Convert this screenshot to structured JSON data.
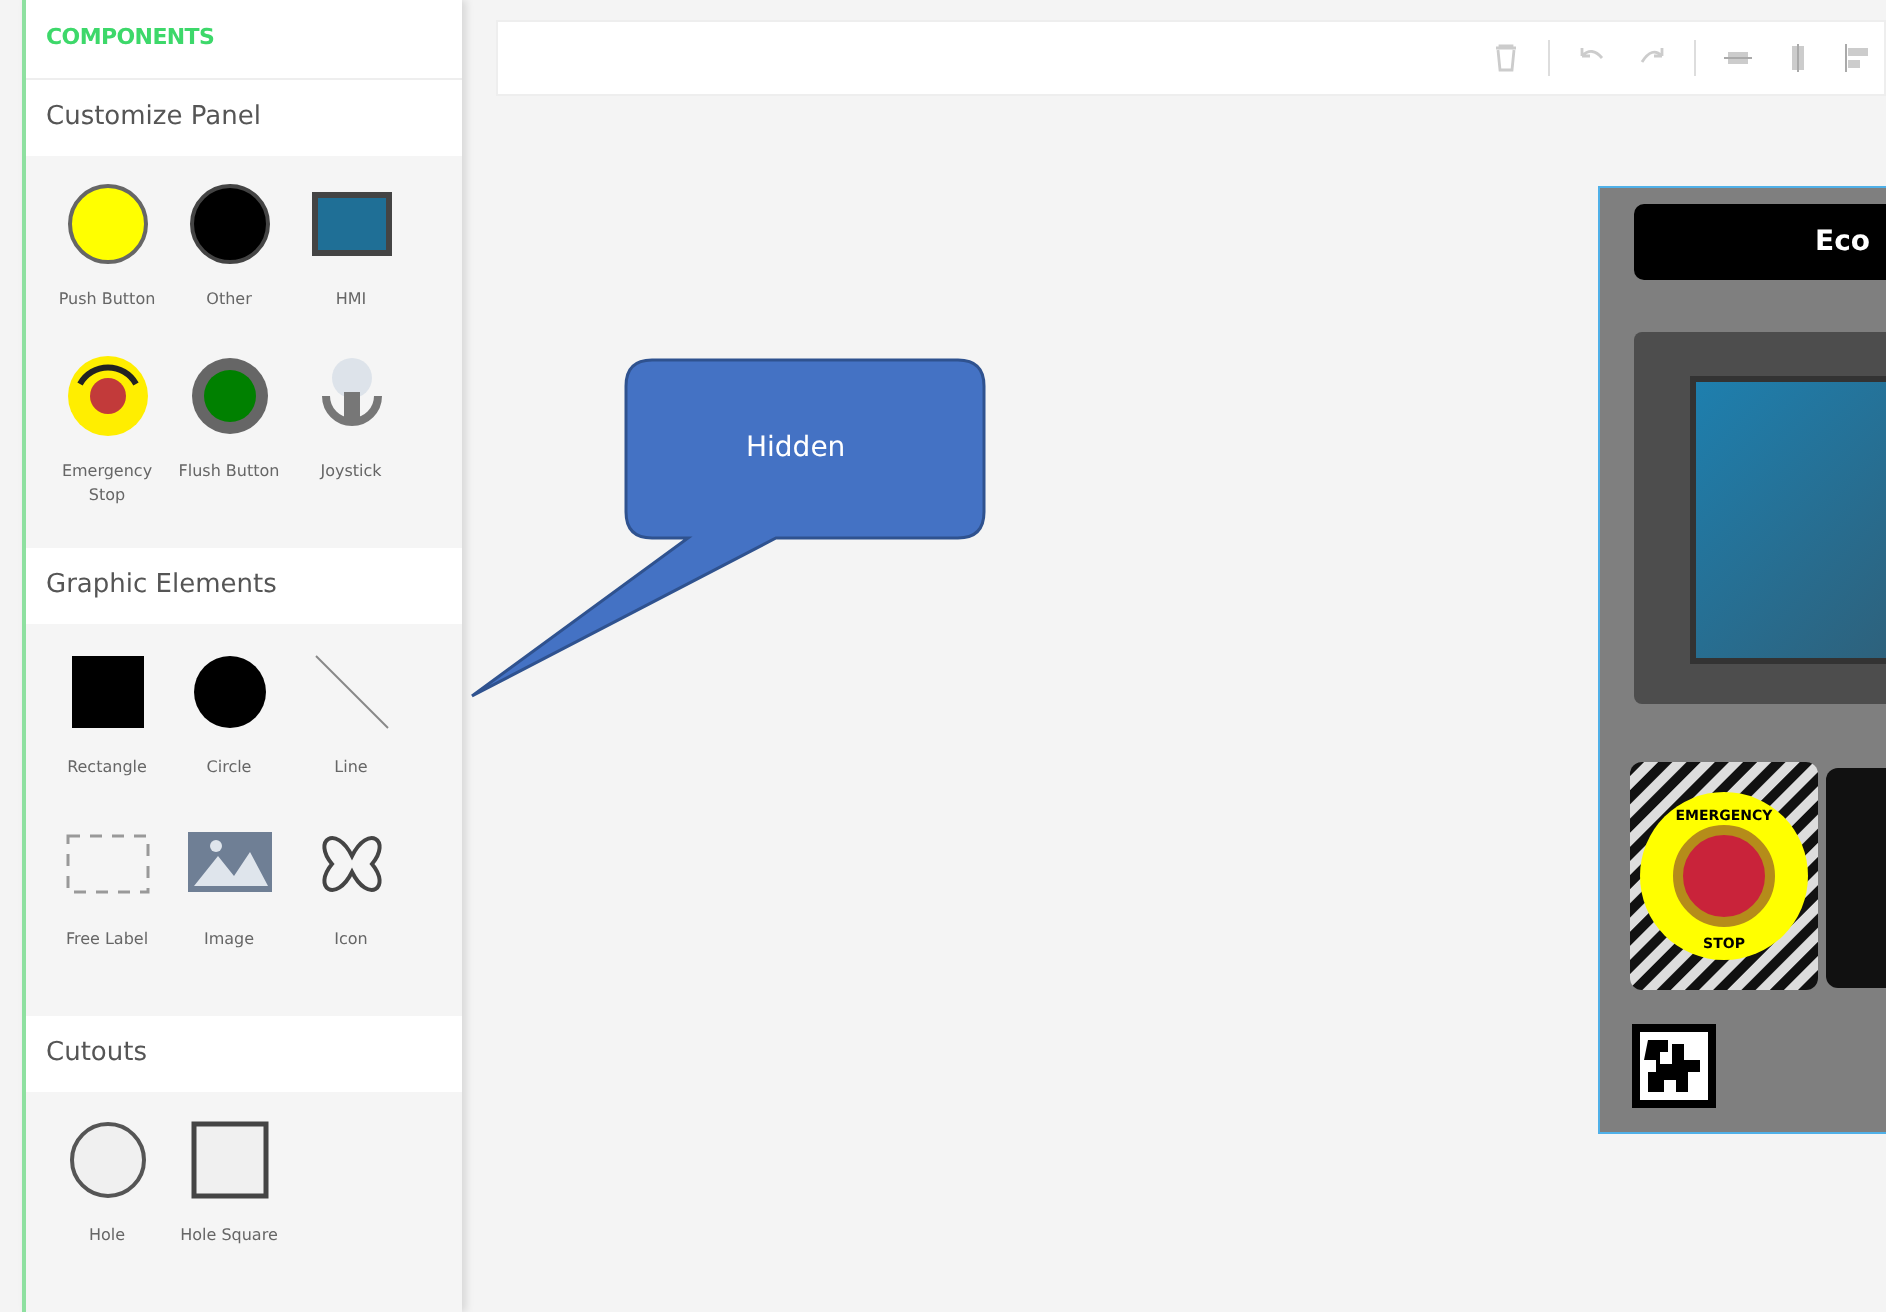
{
  "sidebar": {
    "header": "COMPONENTS",
    "sections": [
      {
        "title": "Customize Panel",
        "items": [
          {
            "label": "Push Button",
            "kind": "push-button"
          },
          {
            "label": "Other",
            "kind": "other"
          },
          {
            "label": "HMI",
            "kind": "hmi"
          },
          {
            "label": "Emergency Stop",
            "kind": "estop"
          },
          {
            "label": "Flush Button",
            "kind": "flush"
          },
          {
            "label": "Joystick",
            "kind": "joystick"
          }
        ]
      },
      {
        "title": "Graphic Elements",
        "items": [
          {
            "label": "Rectangle",
            "kind": "rect"
          },
          {
            "label": "Circle",
            "kind": "circle"
          },
          {
            "label": "Line",
            "kind": "line"
          },
          {
            "label": "Free Label",
            "kind": "free-label"
          },
          {
            "label": "Image",
            "kind": "image"
          },
          {
            "label": "Icon",
            "kind": "icon"
          }
        ]
      },
      {
        "title": "Cutouts",
        "items": [
          {
            "label": "Hole",
            "kind": "hole"
          },
          {
            "label": "Hole Square",
            "kind": "hole-square"
          }
        ]
      }
    ]
  },
  "canvas": {
    "callout": {
      "text": "Hidden"
    },
    "panel": {
      "logo": "Eco",
      "estop_top": "EMERGENCY",
      "estop_bottom": "STOP"
    }
  }
}
